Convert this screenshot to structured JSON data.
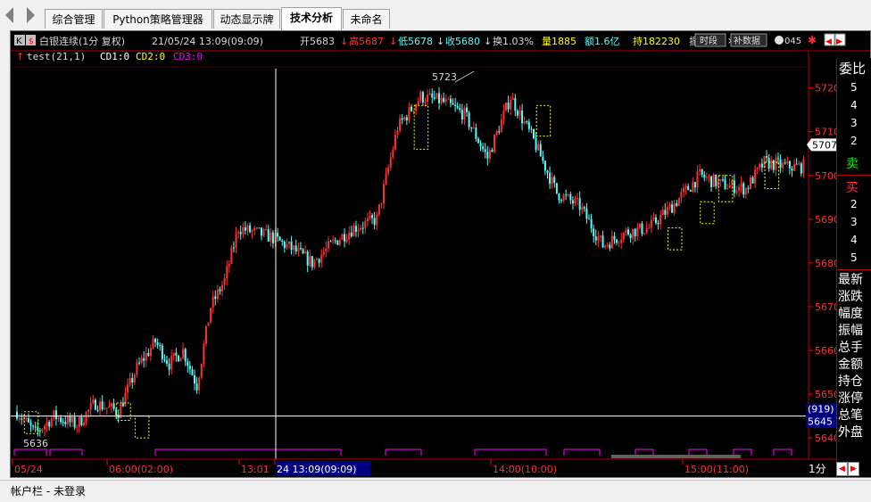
{
  "tabs": [
    {
      "label": "综合管理"
    },
    {
      "label": "Python策略管理器"
    },
    {
      "label": "动态显示牌"
    },
    {
      "label": "技术分析"
    },
    {
      "label": "未命名"
    }
  ],
  "header": {
    "k_icon": "K",
    "symbol": "白银连续(1分 复权)",
    "datetime": "21/05/24 13:09(09:09)",
    "open": "开5683",
    "high": "高5687",
    "low": "低5678",
    "close": "收5680",
    "change_rate": "换1.03%",
    "volume": "量1885",
    "amount": "额1.6亿",
    "open_interest": "持182230",
    "more": "振",
    "btn_time": "时段",
    "btn_supplement": "补数据",
    "right_fragment": "045"
  },
  "indicator": {
    "name": "test(21,1)",
    "cd1": "CD1:0",
    "cd2": "CD2:0",
    "cd3": "CD3:0",
    "colors": {
      "cd1": "#ffffff",
      "cd2": "#ffff00",
      "cd3": "#ff00ff"
    }
  },
  "chart_data": {
    "type": "candlestick",
    "y_ticks": [
      5720,
      5710,
      5700,
      5690,
      5680,
      5670,
      5660,
      5650,
      5640
    ],
    "ylim": [
      5638,
      5724
    ],
    "last_price": "5707",
    "crosshair_price": "5645",
    "crosshair_volume": "(919)",
    "annot_high": "5723",
    "annot_low": "5636",
    "x_labels": [
      "05/24",
      "06:00(02:00)",
      "13:01",
      "24 13:09(09:09)",
      "14:00(10:00)",
      "15:00(11:00)"
    ],
    "period": "1分",
    "colors": {
      "up": "#ff3030",
      "down": "#54ffff",
      "box": "#ffff00",
      "tick": "#ff0000",
      "indicator": "#ff00ff"
    }
  },
  "side_panel": {
    "header": "委比",
    "ask_levels": [
      "5",
      "4",
      "3",
      "2"
    ],
    "sell": "卖",
    "buy": "买",
    "bid_levels": [
      "2",
      "3",
      "4",
      "5"
    ],
    "fields": [
      "最新",
      "涨跌",
      "幅度",
      "振幅",
      "总手",
      "金额",
      "持仓",
      "涨停",
      "总笔",
      "外盘"
    ]
  },
  "status": {
    "text": "帐户栏 - 未登录"
  }
}
